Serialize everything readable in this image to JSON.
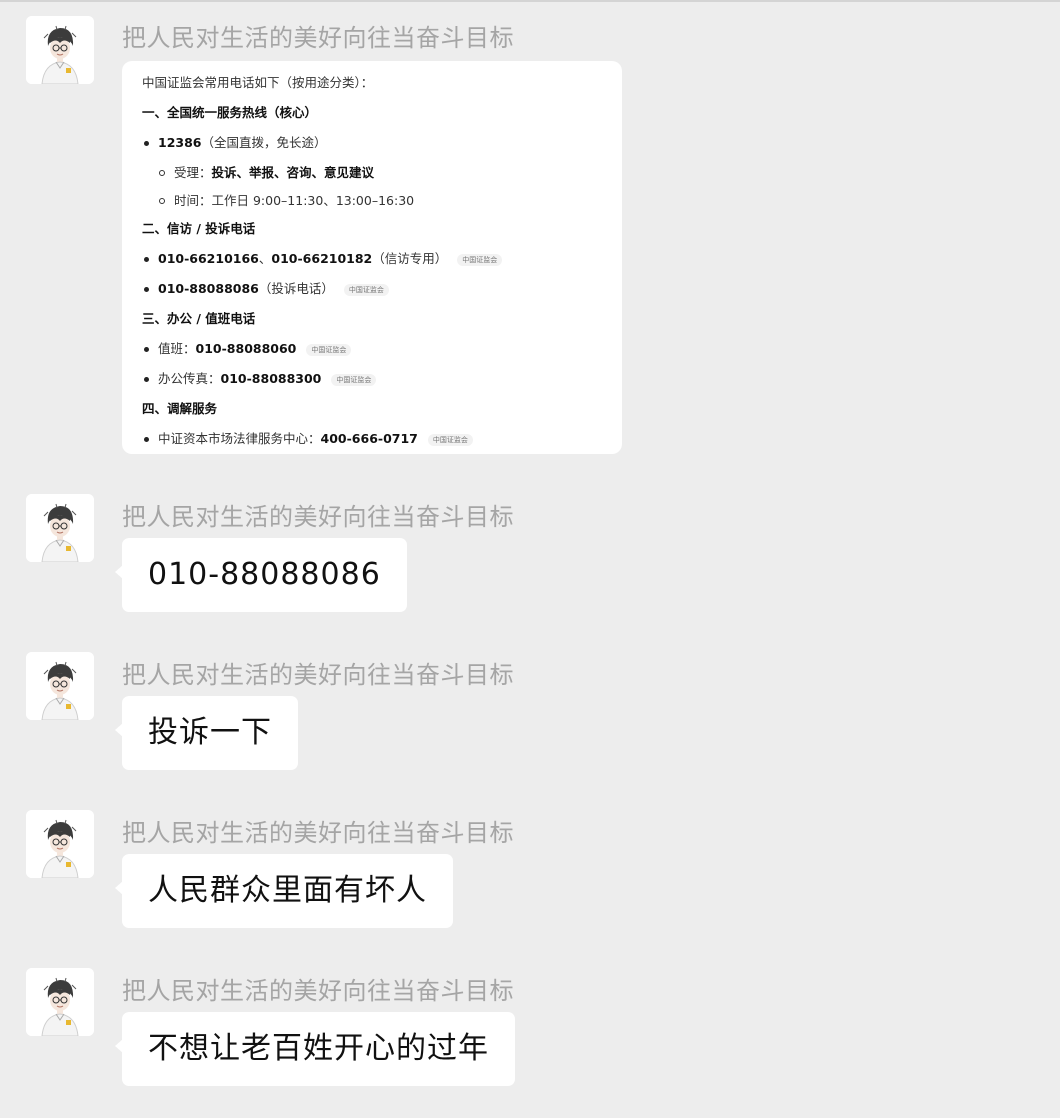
{
  "sender_name": "把人民对生活的美好向往当奋斗目标",
  "card": {
    "intro": "中国证监会常用电话如下（按用途分类）：",
    "section1": {
      "heading": "一、全国统一服务热线（核心）",
      "item_number": "12386",
      "item_note": "（全国直拨，免长途）",
      "accept_label": "受理：",
      "accept_value": "投诉、举报、咨询、意见建议",
      "time_text": "时间：工作日 9:00–11:30、13:00–16:30"
    },
    "section2": {
      "heading": "二、信访 / 投诉电话",
      "item1_num1": "010-66210166",
      "item1_sep": "、",
      "item1_num2": "010-66210182",
      "item1_note": "（信访专用）",
      "item2_num": "010-88088086",
      "item2_note": "（投诉电话）"
    },
    "section3": {
      "heading": "三、办公 / 值班电话",
      "duty_label": "值班：",
      "duty_num": "010-88088060",
      "fax_label": "办公传真：",
      "fax_num": "010-88088300"
    },
    "section4": {
      "heading": "四、调解服务",
      "item_label": "中证资本市场法律服务中心：",
      "item_num": "400-666-0717"
    },
    "source_tag": "中国证监会"
  },
  "messages": [
    {
      "text": "010-88088086"
    },
    {
      "text": "投诉一下"
    },
    {
      "text": "人民群众里面有坏人"
    },
    {
      "text": "不想让老百姓开心的过年"
    }
  ],
  "colors": {
    "background": "#ededed",
    "bubble": "#ffffff",
    "sender_name": "#a5a5a5",
    "text": "#111111"
  },
  "icons": {
    "avatar": "anime-boy-avatar-icon"
  }
}
